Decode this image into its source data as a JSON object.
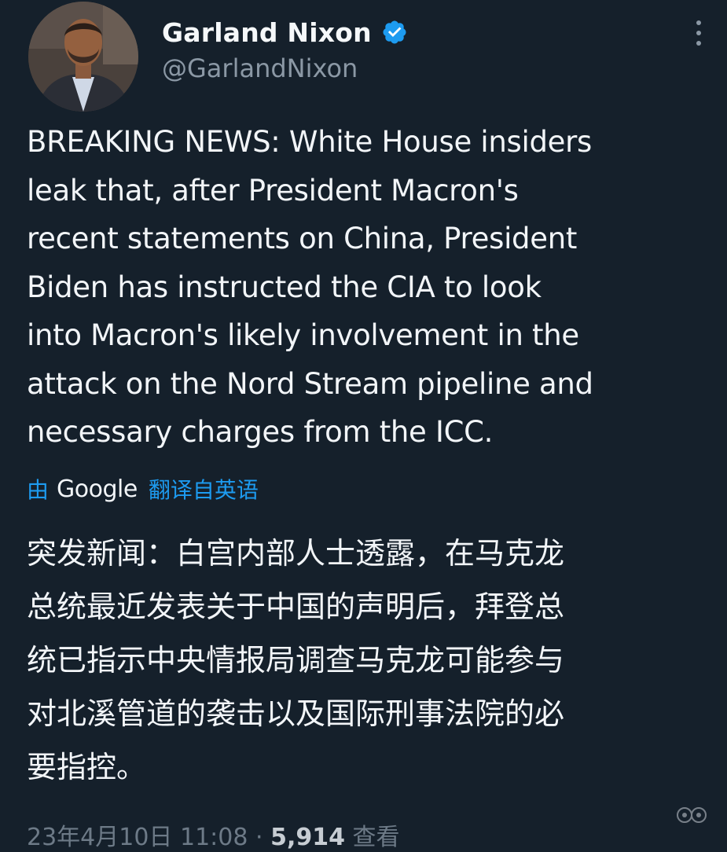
{
  "author": {
    "name": "Garland Nixon",
    "handle": "@GarlandNixon",
    "verified": true
  },
  "tweet": {
    "lines": [
      "BREAKING NEWS: White House insiders",
      "leak that, after President Macron's",
      "recent statements on China, President",
      "Biden has instructed the CIA to look",
      "into Macron's likely involvement in the",
      "attack on the Nord Stream pipeline and",
      "necessary charges from the ICC."
    ]
  },
  "translation": {
    "by_label": "由",
    "provider": "Google",
    "translated_label": "翻译自英语",
    "lines": [
      "突发新闻：白宫内部人士透露，在马克龙",
      "总统最近发表关于中国的声明后，拜登总",
      "统已指示中央情报局调查马克龙可能参与",
      "对北溪管道的袭击以及国际刑事法院的必",
      "要指控。"
    ]
  },
  "meta": {
    "date": "23年4月10日",
    "time": "11:08",
    "separator": "·",
    "views_count": "5,914",
    "views_label": "查看"
  },
  "colors": {
    "background": "#15202b",
    "link": "#1d9bf0",
    "secondary_text": "#8b98a5",
    "primary_text": "#f2f5f8"
  },
  "icons": {
    "verified": "verified-badge-icon",
    "more": "more-vertical-icon"
  }
}
